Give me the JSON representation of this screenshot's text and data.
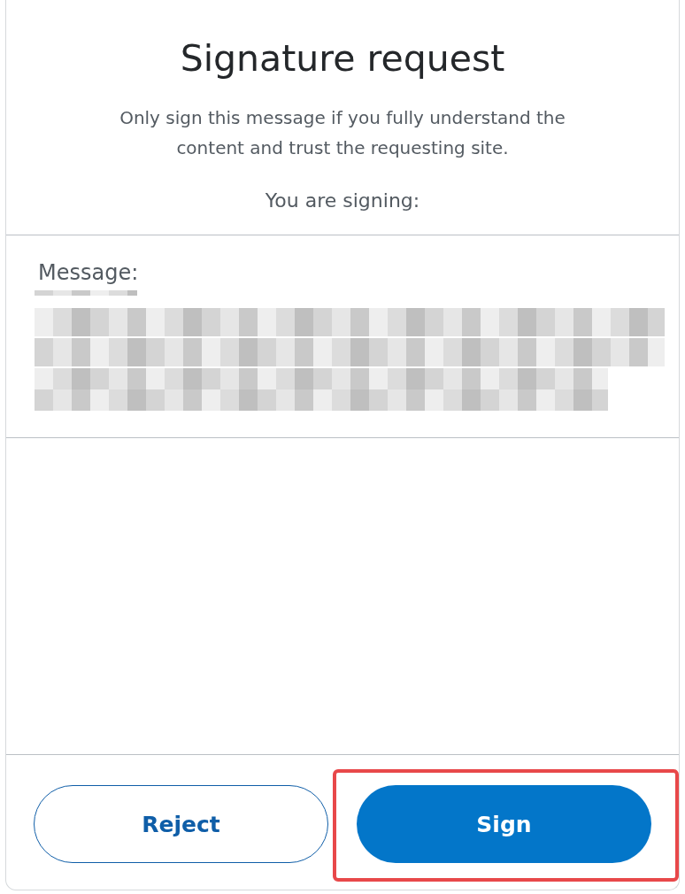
{
  "title": "Signature request",
  "notice": "Only sign this message if you fully understand the content and trust the requesting site.",
  "signing_label": "You are signing:",
  "message": {
    "label": "Message:"
  },
  "buttons": [
    {
      "label": "Reject",
      "kind": "secondary",
      "highlighted": false
    },
    {
      "label": "Sign",
      "kind": "primary",
      "highlighted": true
    }
  ]
}
